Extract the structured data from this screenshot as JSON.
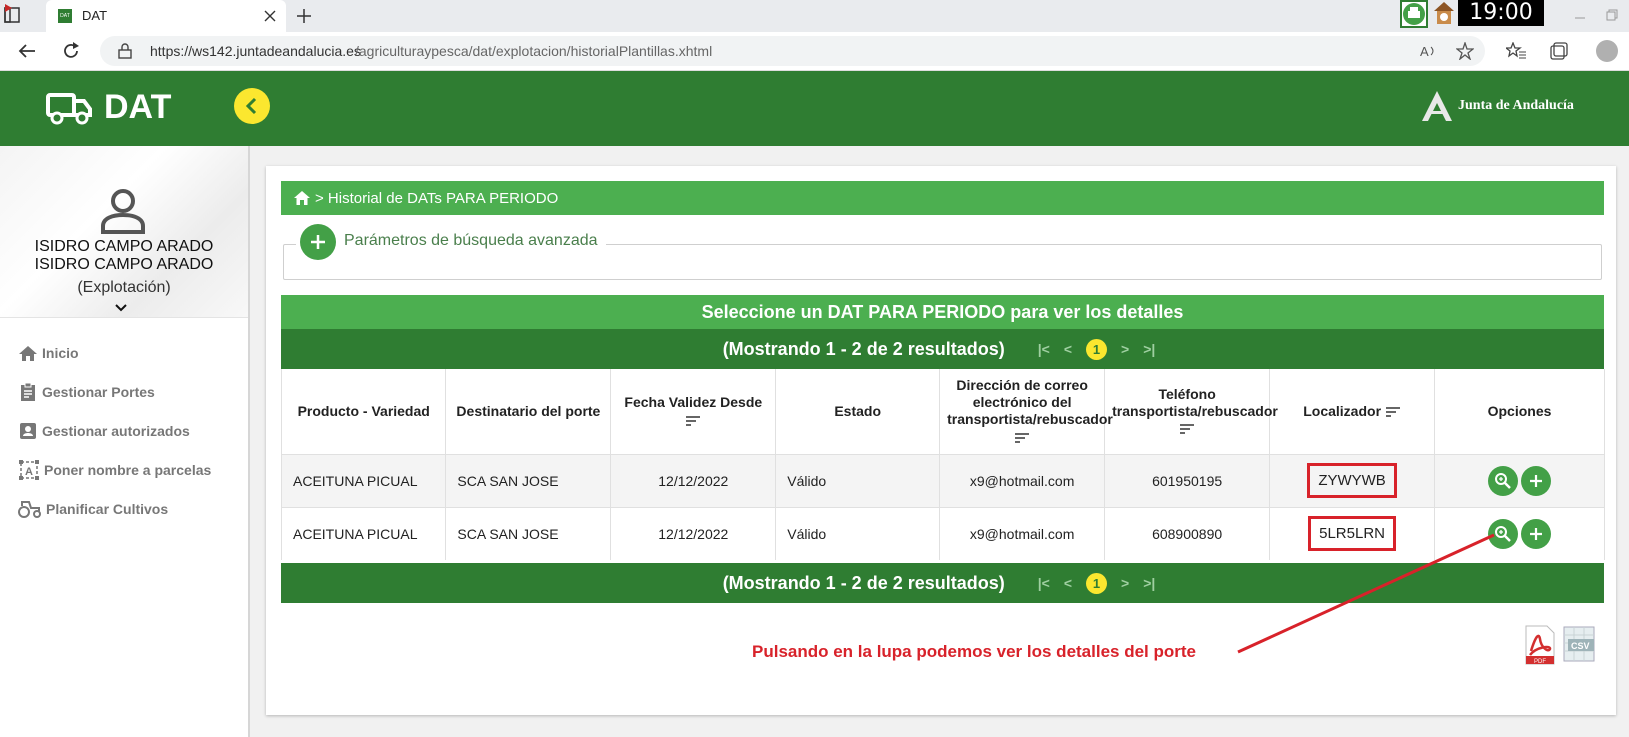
{
  "browser": {
    "tab_title": "DAT",
    "tab_favicon": "DAT",
    "clock": "19:00",
    "url_host": "https://ws142.juntadeandalucia.es",
    "url_path": "/agriculturaypesca/dat/explotacion/historialPlantillas.xhtml"
  },
  "header": {
    "app_name": "DAT",
    "brand": "Junta de Andalucía"
  },
  "user": {
    "name_line1": "ISIDRO CAMPO ARADO",
    "name_line2": "ISIDRO CAMPO ARADO",
    "role": "(Explotación)"
  },
  "nav": {
    "items": [
      {
        "label": "Inicio",
        "icon": "home-icon"
      },
      {
        "label": "Gestionar Portes",
        "icon": "clipboard-icon"
      },
      {
        "label": "Gestionar autorizados",
        "icon": "contact-icon"
      },
      {
        "label": "Poner nombre a parcelas",
        "icon": "text-frame-icon"
      },
      {
        "label": "Planificar Cultivos",
        "icon": "tractor-icon"
      }
    ]
  },
  "breadcrumb": {
    "text": "> Historial de DATs PARA PERIODO"
  },
  "search": {
    "legend": "Parámetros de búsqueda avanzada"
  },
  "table": {
    "caption": "Seleccione un DAT PARA PERIODO para ver los detalles",
    "pager_text": "(Mostrando 1 - 2 de 2 resultados)",
    "current_page": "1",
    "columns": [
      {
        "label": "Producto - Variedad",
        "sortable": false
      },
      {
        "label": "Destinatario del porte",
        "sortable": false
      },
      {
        "label": "Fecha Validez Desde",
        "sortable": true
      },
      {
        "label": "Estado",
        "sortable": false
      },
      {
        "label": "Dirección de correo electrónico del transportista/rebuscador",
        "sortable": true
      },
      {
        "label": "Teléfono transportista/rebuscador",
        "sortable": true
      },
      {
        "label": "Localizador",
        "sortable": true
      },
      {
        "label": "Opciones",
        "sortable": false
      }
    ],
    "rows": [
      {
        "producto": "ACEITUNA PICUAL",
        "destinatario": "SCA SAN JOSE",
        "fecha": "12/12/2022",
        "estado": "Válido",
        "email": "x9@hotmail.com",
        "telefono": "601950195",
        "localizador": "ZYWYWB"
      },
      {
        "producto": "ACEITUNA PICUAL",
        "destinatario": "SCA SAN JOSE",
        "fecha": "12/12/2022",
        "estado": "Válido",
        "email": "x9@hotmail.com",
        "telefono": "608900890",
        "localizador": "5LR5LRN"
      }
    ]
  },
  "annotation": {
    "text": "Pulsando en la lupa podemos ver los detalles del porte"
  },
  "exports": {
    "pdf_label": "PDF",
    "csv_label": "CSV"
  },
  "colors": {
    "primary_green": "#2f7d32",
    "light_green": "#4caf50",
    "accent_yellow": "#fbe72f",
    "annotation_red": "#d8222a"
  }
}
